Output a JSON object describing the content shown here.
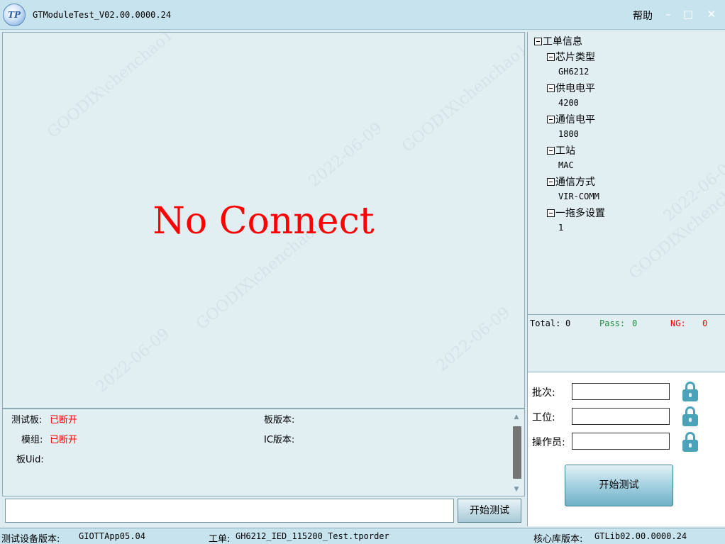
{
  "titlebar": {
    "logo_text": "TP",
    "title": "GTModuleTest_V02.00.0000.24",
    "help": "帮助",
    "minimize": "–",
    "maximize": "□",
    "close": "✕"
  },
  "main": {
    "status_message": "No Connect"
  },
  "watermark": {
    "user": "GOODIX\\chenchao1",
    "date": "2022-06-09"
  },
  "info": {
    "test_board_label": "测试板:",
    "test_board_value": "已断开",
    "module_label": "模组:",
    "module_value": "已断开",
    "board_uid_label": "板Uid:",
    "board_version_label": "板版本:",
    "ic_version_label": "IC版本:"
  },
  "command": {
    "input_value": "",
    "start_button": "开始测试"
  },
  "tree": {
    "nodes": [
      {
        "label": "工单信息"
      },
      {
        "label": "芯片类型",
        "value": "GH6212"
      },
      {
        "label": "供电电平",
        "value": "4200"
      },
      {
        "label": "通信电平",
        "value": "1800"
      },
      {
        "label": "工站",
        "value": "MAC"
      },
      {
        "label": "通信方式",
        "value": "VIR-COMM"
      },
      {
        "label": "一拖多设置",
        "value": "1"
      }
    ]
  },
  "stats": {
    "total_label": "Total:",
    "total_value": "0",
    "pass_label": "Pass:",
    "pass_value": "0",
    "ng_label": "NG:",
    "ng_value": "0",
    "colors": {
      "pass": "#1f8a3a",
      "ng": "#ff0000"
    }
  },
  "form": {
    "batch_label": "批次:",
    "batch_value": "",
    "station_label": "工位:",
    "station_value": "",
    "operator_label": "操作员:",
    "operator_value": "",
    "start_button": "开始测试",
    "lock_icon": "lock-icon"
  },
  "statusbar": {
    "device_version_label": "测试设备版本:",
    "device_version_value": "GIOTTApp05.04",
    "work_order_label": "工单:",
    "work_order_value": "GH6212_IED_115200_Test.tporder",
    "core_lib_label": "核心库版本:",
    "core_lib_value": "GTLib02.00.0000.24"
  }
}
